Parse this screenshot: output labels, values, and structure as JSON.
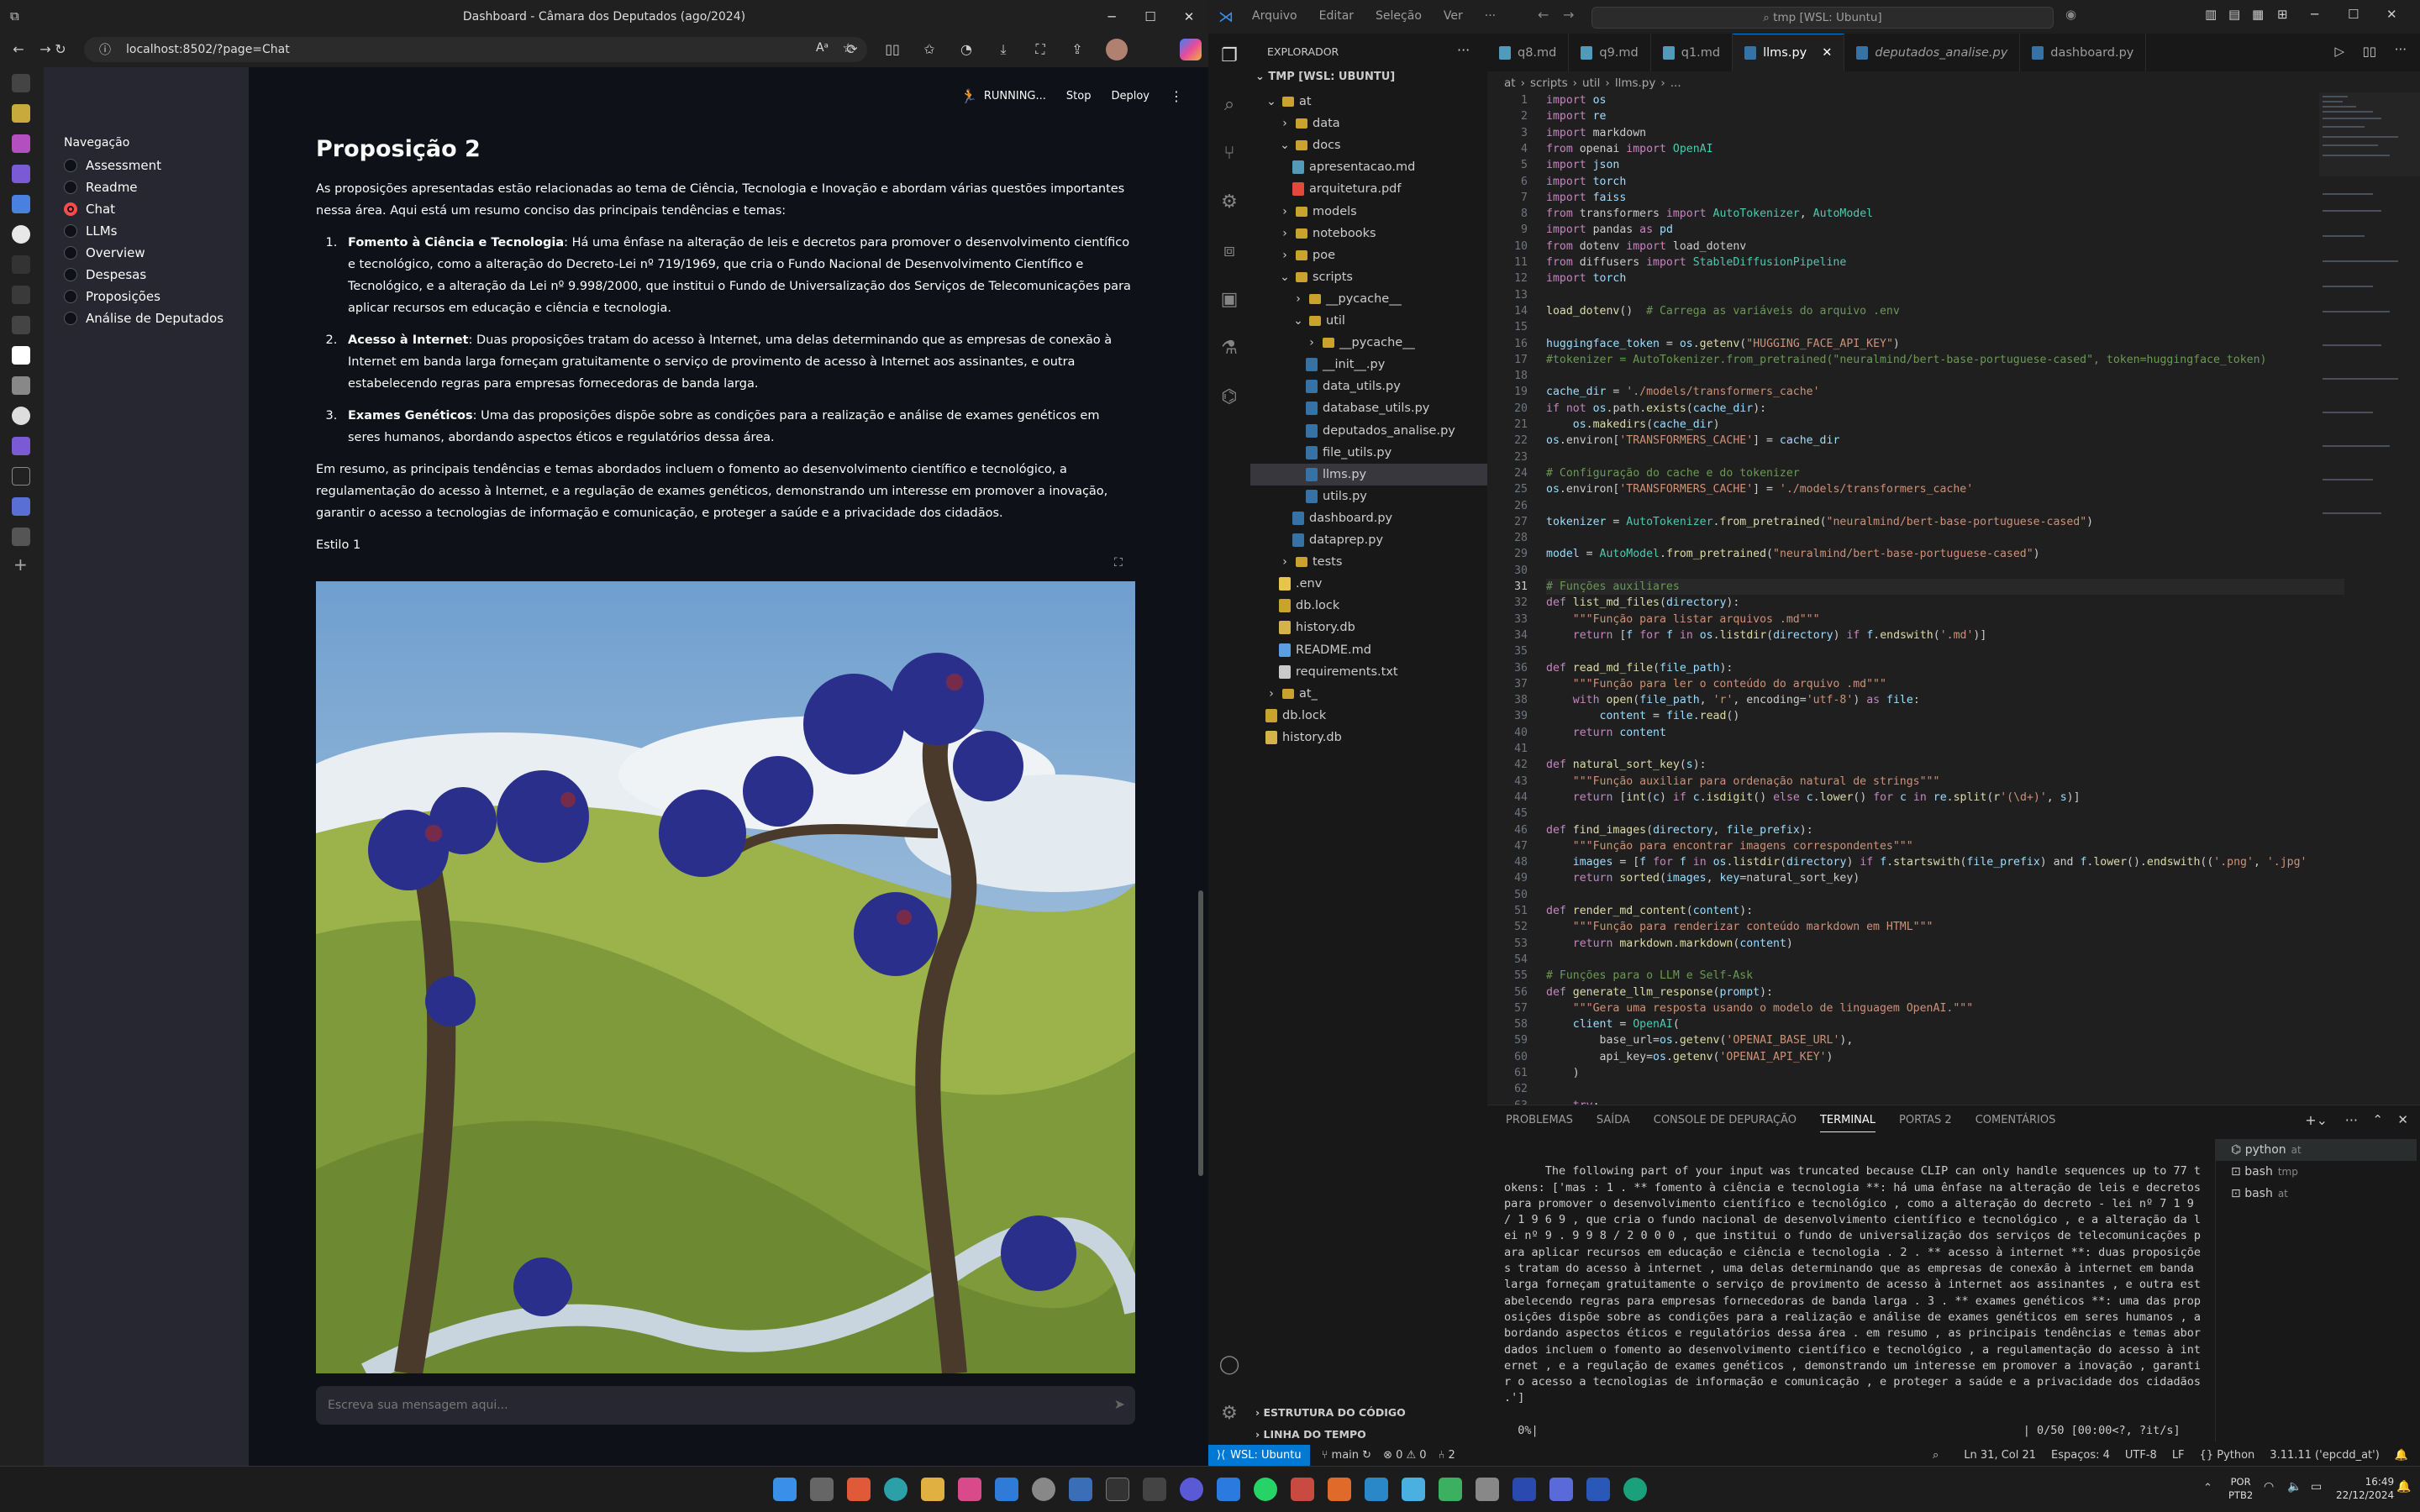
{
  "browser": {
    "window_title": "Dashboard - Câmara dos Deputados (ago/2024)",
    "url": "localhost:8502/?page=Chat"
  },
  "streamlit": {
    "nav_title": "Navegação",
    "nav_items": [
      "Assessment",
      "Readme",
      "Chat",
      "LLMs",
      "Overview",
      "Despesas",
      "Proposições",
      "Análise de Deputados"
    ],
    "selected": "Chat",
    "status": "RUNNING...",
    "stop": "Stop",
    "deploy": "Deploy",
    "heading": "Proposição 2",
    "intro": "As proposições apresentadas estão relacionadas ao tema de Ciência, Tecnologia e Inovação e abordam várias questões importantes nessa área. Aqui está um resumo conciso das principais tendências e temas:",
    "items": [
      {
        "title": "Fomento à Ciência e Tecnologia",
        "text": ": Há uma ênfase na alteração de leis e decretos para promover o desenvolvimento científico e tecnológico, como a alteração do Decreto-Lei nº 719/1969, que cria o Fundo Nacional de Desenvolvimento Científico e Tecnológico, e a alteração da Lei nº 9.998/2000, que institui o Fundo de Universalização dos Serviços de Telecomunicações para aplicar recursos em educação e ciência e tecnologia."
      },
      {
        "title": "Acesso à Internet",
        "text": ": Duas proposições tratam do acesso à Internet, uma delas determinando que as empresas de conexão à Internet em banda larga forneçam gratuitamente o serviço de provimento de acesso à Internet aos assinantes, e outra estabelecendo regras para empresas fornecedoras de banda larga."
      },
      {
        "title": "Exames Genéticos",
        "text": ": Uma das proposições dispõe sobre as condições para a realização e análise de exames genéticos em seres humanos, abordando aspectos éticos e regulatórios dessa área."
      }
    ],
    "summary": "Em resumo, as principais tendências e temas abordados incluem o fomento ao desenvolvimento científico e tecnológico, a regulamentação do acesso à Internet, e a regulação de exames genéticos, demonstrando um interesse em promover a inovação, garantir o acesso a tecnologias de informação e comunicação, e proteger a saúde e a privacidade dos cidadãos.",
    "style_label": "Estilo 1",
    "chat_placeholder": "Escreva sua mensagem aqui..."
  },
  "vscode": {
    "menu": [
      "Arquivo",
      "Editar",
      "Seleção",
      "Ver",
      "···"
    ],
    "search": "tmp [WSL: Ubuntu]",
    "explorer_title": "EXPLORADOR",
    "root": "TMP [WSL: UBUNTU]",
    "tree": [
      {
        "label": "at",
        "depth": 0,
        "kind": "folder-open"
      },
      {
        "label": "data",
        "depth": 1,
        "kind": "folder"
      },
      {
        "label": "docs",
        "depth": 1,
        "kind": "folder-open"
      },
      {
        "label": "apresentacao.md",
        "depth": 2,
        "kind": "md"
      },
      {
        "label": "arquitetura.pdf",
        "depth": 2,
        "kind": "pdf"
      },
      {
        "label": "models",
        "depth": 1,
        "kind": "folder"
      },
      {
        "label": "notebooks",
        "depth": 1,
        "kind": "folder"
      },
      {
        "label": "poe",
        "depth": 1,
        "kind": "folder"
      },
      {
        "label": "scripts",
        "depth": 1,
        "kind": "folder-open"
      },
      {
        "label": "__pycache__",
        "depth": 2,
        "kind": "folder"
      },
      {
        "label": "util",
        "depth": 2,
        "kind": "folder-open"
      },
      {
        "label": "__pycache__",
        "depth": 3,
        "kind": "folder"
      },
      {
        "label": "__init__.py",
        "depth": 3,
        "kind": "py"
      },
      {
        "label": "data_utils.py",
        "depth": 3,
        "kind": "py"
      },
      {
        "label": "database_utils.py",
        "depth": 3,
        "kind": "py"
      },
      {
        "label": "deputados_analise.py",
        "depth": 3,
        "kind": "py"
      },
      {
        "label": "file_utils.py",
        "depth": 3,
        "kind": "py"
      },
      {
        "label": "llms.py",
        "depth": 3,
        "kind": "py",
        "selected": true
      },
      {
        "label": "utils.py",
        "depth": 3,
        "kind": "py"
      },
      {
        "label": "dashboard.py",
        "depth": 2,
        "kind": "py"
      },
      {
        "label": "dataprep.py",
        "depth": 2,
        "kind": "py"
      },
      {
        "label": "tests",
        "depth": 1,
        "kind": "folder"
      },
      {
        "label": ".env",
        "depth": 1,
        "kind": "env"
      },
      {
        "label": "db.lock",
        "depth": 1,
        "kind": "lock"
      },
      {
        "label": "history.db",
        "depth": 1,
        "kind": "db"
      },
      {
        "label": "README.md",
        "depth": 1,
        "kind": "info"
      },
      {
        "label": "requirements.txt",
        "depth": 1,
        "kind": "txt"
      },
      {
        "label": "at_",
        "depth": 0,
        "kind": "folder"
      },
      {
        "label": "db.lock",
        "depth": 0,
        "kind": "lock"
      },
      {
        "label": "history.db",
        "depth": 0,
        "kind": "db"
      }
    ],
    "outline": "ESTRUTURA DO CÓDIGO",
    "timeline": "LINHA DO TEMPO",
    "tabs": [
      "q8.md",
      "q9.md",
      "q1.md",
      "llms.py",
      "deputados_analise.py",
      "dashboard.py"
    ],
    "active_tab": "llms.py",
    "breadcrumb": [
      "at",
      "scripts",
      "util",
      "llms.py",
      "..."
    ],
    "code": [
      [
        1,
        "import os"
      ],
      [
        2,
        "import re"
      ],
      [
        3,
        "import markdown"
      ],
      [
        4,
        "from openai import OpenAI"
      ],
      [
        5,
        "import json"
      ],
      [
        6,
        "import torch"
      ],
      [
        7,
        "import faiss"
      ],
      [
        8,
        "from transformers import AutoTokenizer, AutoModel"
      ],
      [
        9,
        "import pandas as pd"
      ],
      [
        10,
        "from dotenv import load_dotenv"
      ],
      [
        11,
        "from diffusers import StableDiffusionPipeline"
      ],
      [
        12,
        "import torch"
      ],
      [
        13,
        ""
      ],
      [
        14,
        "load_dotenv()  # Carrega as variáveis do arquivo .env"
      ],
      [
        15,
        ""
      ],
      [
        16,
        "huggingface_token = os.getenv(\"HUGGING_FACE_API_KEY\")"
      ],
      [
        17,
        "#tokenizer = AutoTokenizer.from_pretrained(\"neuralmind/bert-base-portuguese-cased\", token=huggingface_token)"
      ],
      [
        18,
        ""
      ],
      [
        19,
        "cache_dir = './models/transformers_cache'"
      ],
      [
        20,
        "if not os.path.exists(cache_dir):"
      ],
      [
        21,
        "    os.makedirs(cache_dir)"
      ],
      [
        22,
        "os.environ['TRANSFORMERS_CACHE'] = cache_dir"
      ],
      [
        23,
        ""
      ],
      [
        24,
        "# Configuração do cache e do tokenizer"
      ],
      [
        25,
        "os.environ['TRANSFORMERS_CACHE'] = './models/transformers_cache'"
      ],
      [
        26,
        ""
      ],
      [
        27,
        "tokenizer = AutoTokenizer.from_pretrained(\"neuralmind/bert-base-portuguese-cased\")"
      ],
      [
        28,
        ""
      ],
      [
        29,
        "model = AutoModel.from_pretrained(\"neuralmind/bert-base-portuguese-cased\")"
      ],
      [
        30,
        ""
      ],
      [
        31,
        "# Funções auxiliares"
      ],
      [
        32,
        "def list_md_files(directory):"
      ],
      [
        33,
        "    \"\"\"Função para listar arquivos .md\"\"\""
      ],
      [
        34,
        "    return [f for f in os.listdir(directory) if f.endswith('.md')]"
      ],
      [
        35,
        ""
      ],
      [
        36,
        "def read_md_file(file_path):"
      ],
      [
        37,
        "    \"\"\"Função para ler o conteúdo do arquivo .md\"\"\""
      ],
      [
        38,
        "    with open(file_path, 'r', encoding='utf-8') as file:"
      ],
      [
        39,
        "        content = file.read()"
      ],
      [
        40,
        "    return content"
      ],
      [
        41,
        ""
      ],
      [
        42,
        "def natural_sort_key(s):"
      ],
      [
        43,
        "    \"\"\"Função auxiliar para ordenação natural de strings\"\"\""
      ],
      [
        44,
        "    return [int(c) if c.isdigit() else c.lower() for c in re.split(r'(\\d+)', s)]"
      ],
      [
        45,
        ""
      ],
      [
        46,
        "def find_images(directory, file_prefix):"
      ],
      [
        47,
        "    \"\"\"Função para encontrar imagens correspondentes\"\"\""
      ],
      [
        48,
        "    images = [f for f in os.listdir(directory) if f.startswith(file_prefix) and f.lower().endswith(('.png', '.jpg'"
      ],
      [
        49,
        "    return sorted(images, key=natural_sort_key)"
      ],
      [
        50,
        ""
      ],
      [
        51,
        "def render_md_content(content):"
      ],
      [
        52,
        "    \"\"\"Função para renderizar conteúdo markdown em HTML\"\"\""
      ],
      [
        53,
        "    return markdown.markdown(content)"
      ],
      [
        54,
        ""
      ],
      [
        55,
        "# Funções para o LLM e Self-Ask"
      ],
      [
        56,
        "def generate_llm_response(prompt):"
      ],
      [
        57,
        "    \"\"\"Gera uma resposta usando o modelo de linguagem OpenAI.\"\"\""
      ],
      [
        58,
        "    client = OpenAI("
      ],
      [
        59,
        "        base_url=os.getenv('OPENAI_BASE_URL'),"
      ],
      [
        60,
        "        api_key=os.getenv('OPENAI_API_KEY')"
      ],
      [
        61,
        "    )"
      ],
      [
        62,
        ""
      ],
      [
        63,
        "    try:"
      ]
    ],
    "panel_tabs": [
      "PROBLEMAS",
      "SAÍDA",
      "CONSOLE DE DEPURAÇÃO",
      "TERMINAL",
      "PORTAS  2",
      "COMENTÁRIOS"
    ],
    "active_panel": "TERMINAL",
    "terminal": "The following part of your input was truncated because CLIP can only handle sequences up to 77 tokens: ['mas : 1 . ** fomento à ciência e tecnologia **: há uma ênfase na alteração de leis e decretos para promover o desenvolvimento científico e tecnológico , como a alteração do decreto - lei nº 7 1 9 / 1 9 6 9 , que cria o fundo nacional de desenvolvimento científico e tecnológico , e a alteração da lei nº 9 . 9 9 8 / 2 0 0 0 , que institui o fundo de universalização dos serviços de telecomunicações para aplicar recursos em educação e ciência e tecnologia . 2 . ** acesso à internet **: duas proposições tratam do acesso à internet , uma delas determinando que as empresas de conexão à internet em banda larga forneçam gratuitamente o serviço de provimento de acesso à internet aos assinantes , e outra estabelecendo regras para empresas fornecedoras de banda larga . 3 . ** exames genéticos **: uma das proposições dispõe sobre as condições para a realização e análise de exames genéticos em seres humanos , abordando aspectos éticos e regulatórios dessa área . em resumo , as principais tendências e temas abordados incluem o fomento ao desenvolvimento científico e tecnológico , a regulamentação do acesso à internet , e a regulação de exames genéticos , demonstrando um interesse em promover a inovação , garantir o acesso a tecnologias de informação e comunicação , e proteger a saúde e a privacidade dos cidadãos .']",
    "terminal_progress": "  0%|                                                                       | 0/50 [00:00<?, ?it/s]",
    "terminals": [
      {
        "name": "python",
        "cwd": "at"
      },
      {
        "name": "bash",
        "cwd": "tmp"
      },
      {
        "name": "bash",
        "cwd": "at"
      }
    ],
    "status": {
      "remote": "WSL: Ubuntu",
      "branch": "main",
      "problems": "⊗ 0  ⚠ 0",
      "ports": "2",
      "position": "Ln 31, Col 21",
      "spaces": "Espaços: 4",
      "encoding": "UTF-8",
      "eol": "LF",
      "language": "Python",
      "interpreter": "3.11.11 ('epcdd_at')"
    }
  },
  "taskbar": {
    "lang": "POR",
    "layout": "PTB2",
    "time": "16:49",
    "date": "22/12/2024"
  }
}
